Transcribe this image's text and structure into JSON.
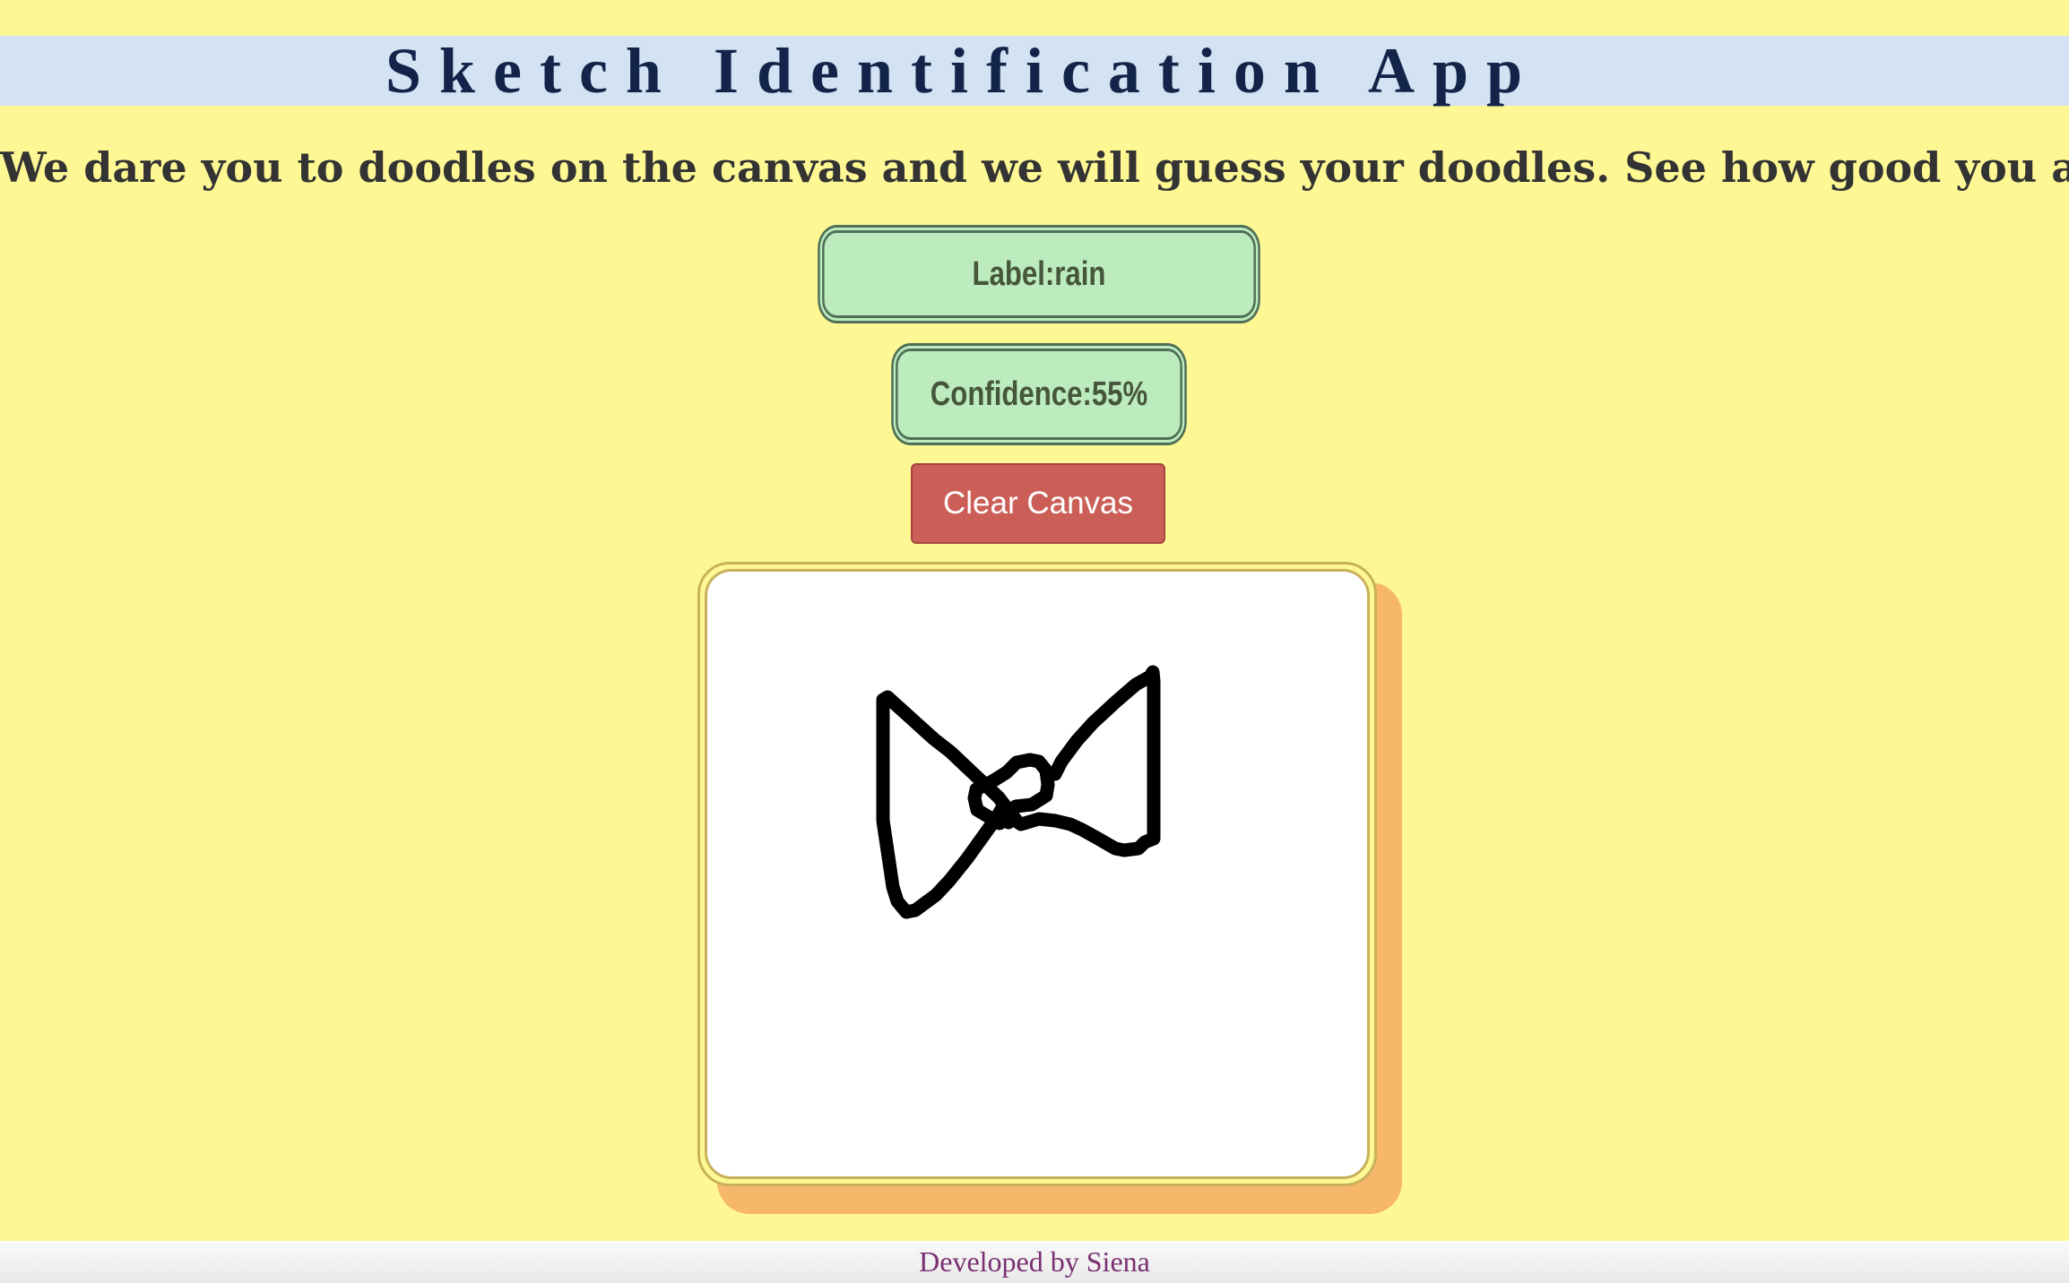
{
  "header": {
    "title": "Sketch Identification App"
  },
  "intro": {
    "tagline": "We dare you to doodles on the canvas and we will guess your doodles. See how good you are!"
  },
  "prediction": {
    "label_text": "Label:rain",
    "confidence_text": "Confidence:55%"
  },
  "controls": {
    "clear_label": "Clear Canvas"
  },
  "footer": {
    "credit": "Developed by Siena"
  },
  "colors": {
    "page_background": "#fef894",
    "header_band": "#d3e3f3",
    "title_text": "#13244a",
    "result_pill": "#bcebbd",
    "clear_button": "#cb5f58",
    "canvas_shadow": "#f7b76b",
    "credit_text": "#7a2f71"
  }
}
